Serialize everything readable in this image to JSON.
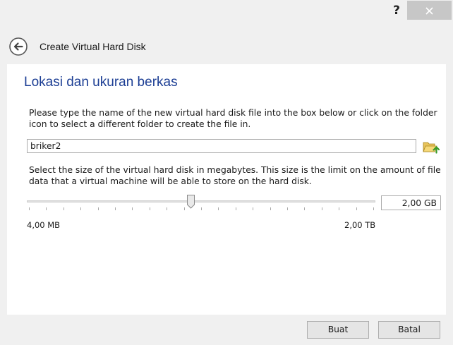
{
  "titlebar": {
    "help_label": "?"
  },
  "header": {
    "title": "Create Virtual Hard Disk"
  },
  "section": {
    "title": "Lokasi dan ukuran berkas"
  },
  "location": {
    "description": "Please type the name of the new virtual hard disk file into the box below or click on the folder icon to select a different folder to create the file in.",
    "filename_value": "briker2"
  },
  "size": {
    "description": "Select the size of the virtual hard disk in megabytes. This size is the limit on the amount of file data that a virtual machine will be able to store on the hard disk.",
    "min_label": "4,00 MB",
    "max_label": "2,00 TB",
    "value_text": "2,00 GB",
    "slider_position_fraction": 0.47
  },
  "buttons": {
    "create_label": "Buat",
    "cancel_label": "Batal"
  },
  "icons": {
    "back": "back-arrow-icon",
    "folder": "folder-icon",
    "close": "close-icon"
  },
  "colors": {
    "section_title": "#1c3e94",
    "chrome_bg": "#f0f0f0",
    "close_bg": "#c7c7c7"
  }
}
